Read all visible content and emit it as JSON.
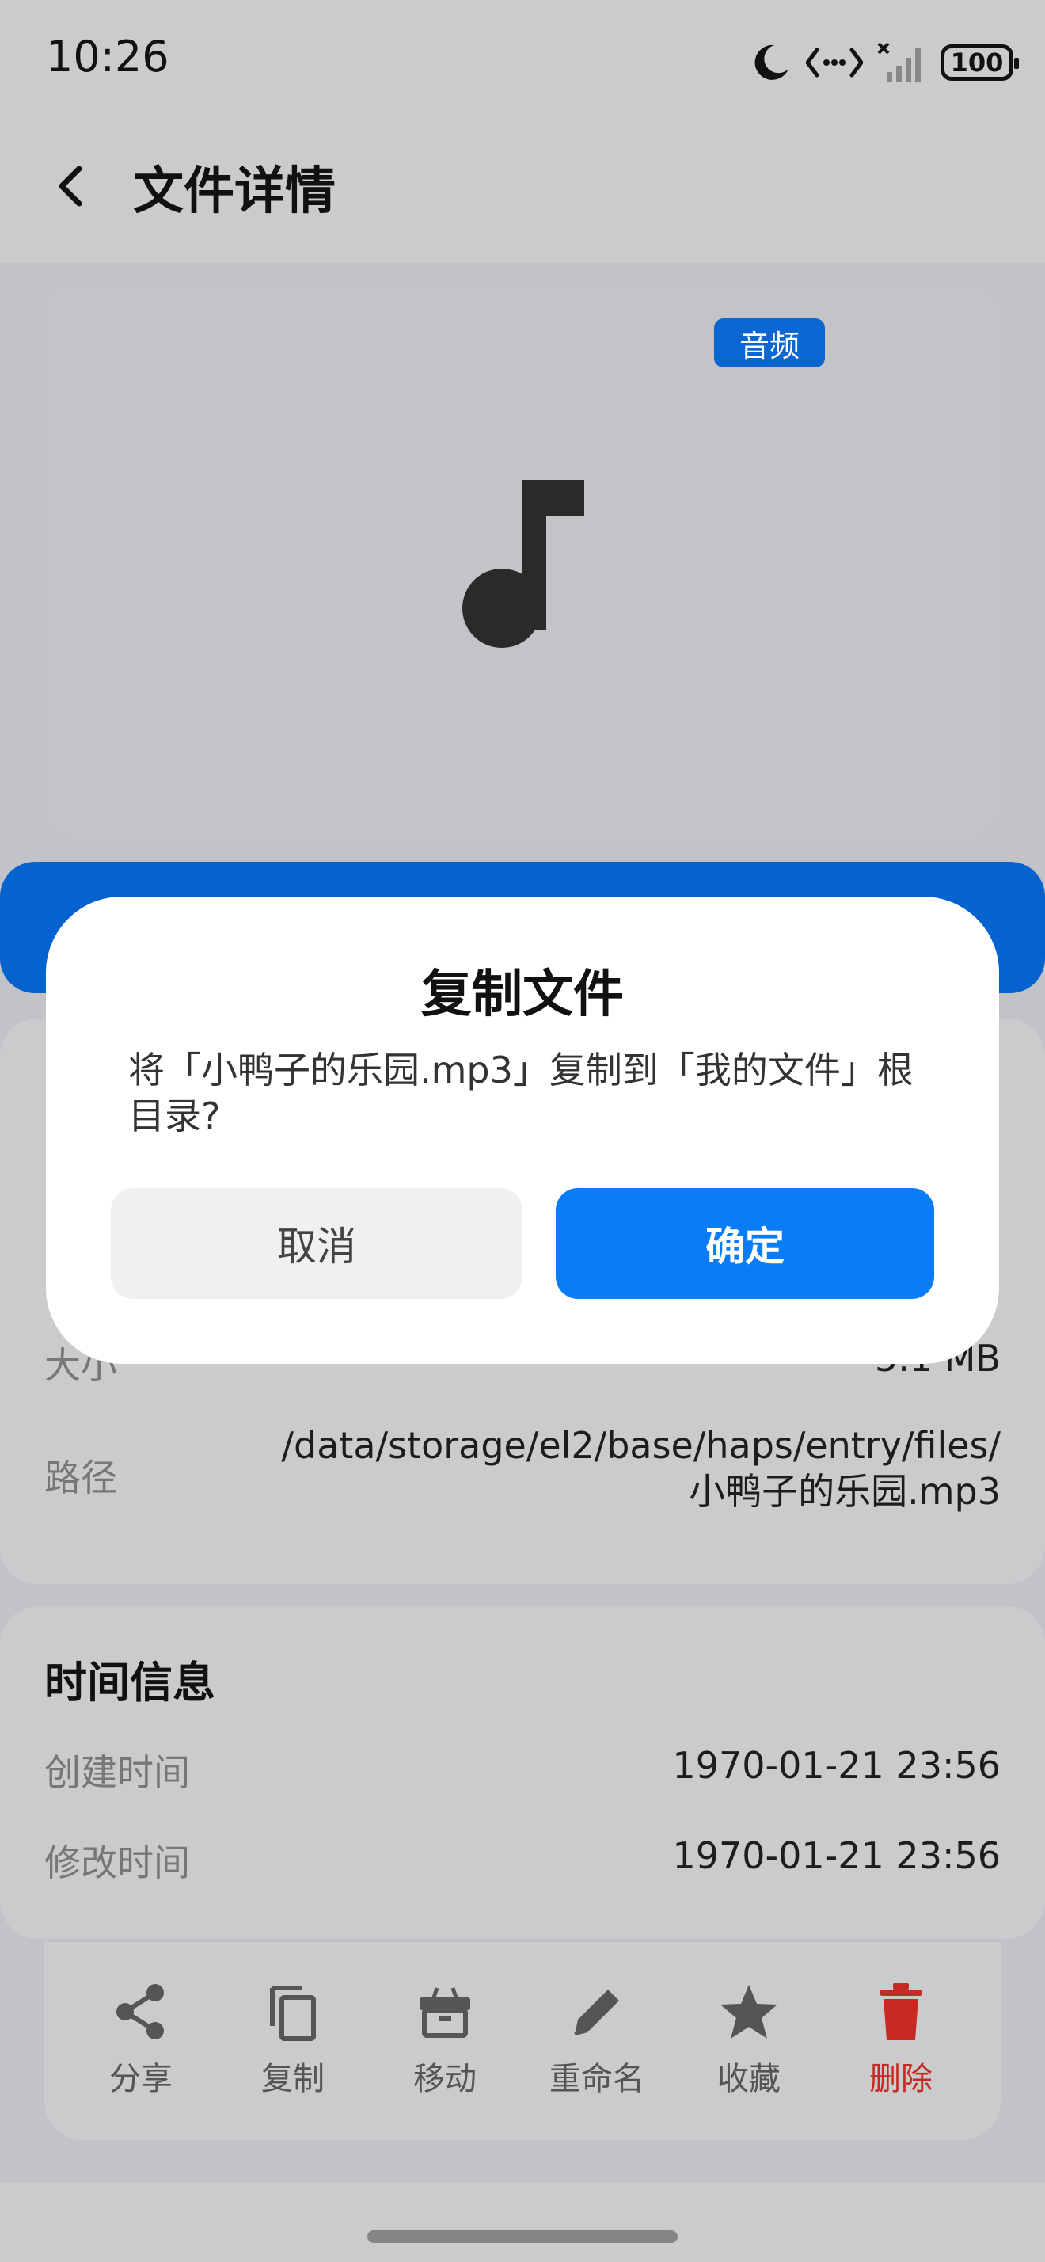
{
  "status_bar": {
    "time": "10:26",
    "battery": "100",
    "icons": [
      "moon-icon",
      "data-transfer-icon",
      "no-signal-icon",
      "battery-icon"
    ]
  },
  "header": {
    "title": "文件详情",
    "back_icon": "chevron-left-icon"
  },
  "preview": {
    "type_badge": "音频",
    "icon": "music-note-icon"
  },
  "info": {
    "size_label": "大小",
    "size_value": "5.1 MB",
    "path_label": "路径",
    "path_value_line1": "/data/storage/el2/base/haps/entry/files/",
    "path_value_line2": "小鸭子的乐园.mp3"
  },
  "time_info": {
    "title": "时间信息",
    "created_label": "创建时间",
    "created_value": "1970-01-21 23:56",
    "modified_label": "修改时间",
    "modified_value": "1970-01-21 23:56"
  },
  "toolbar": {
    "share": "分享",
    "copy": "复制",
    "move": "移动",
    "rename": "重命名",
    "favorite": "收藏",
    "delete": "删除"
  },
  "dialog": {
    "title": "复制文件",
    "message": "将「小鸭子的乐园.mp3」复制到「我的文件」根目录?",
    "cancel": "取消",
    "confirm": "确定"
  },
  "colors": {
    "accent": "#0a7cf8",
    "badge": "#0a66d0",
    "danger": "#c62a22"
  }
}
